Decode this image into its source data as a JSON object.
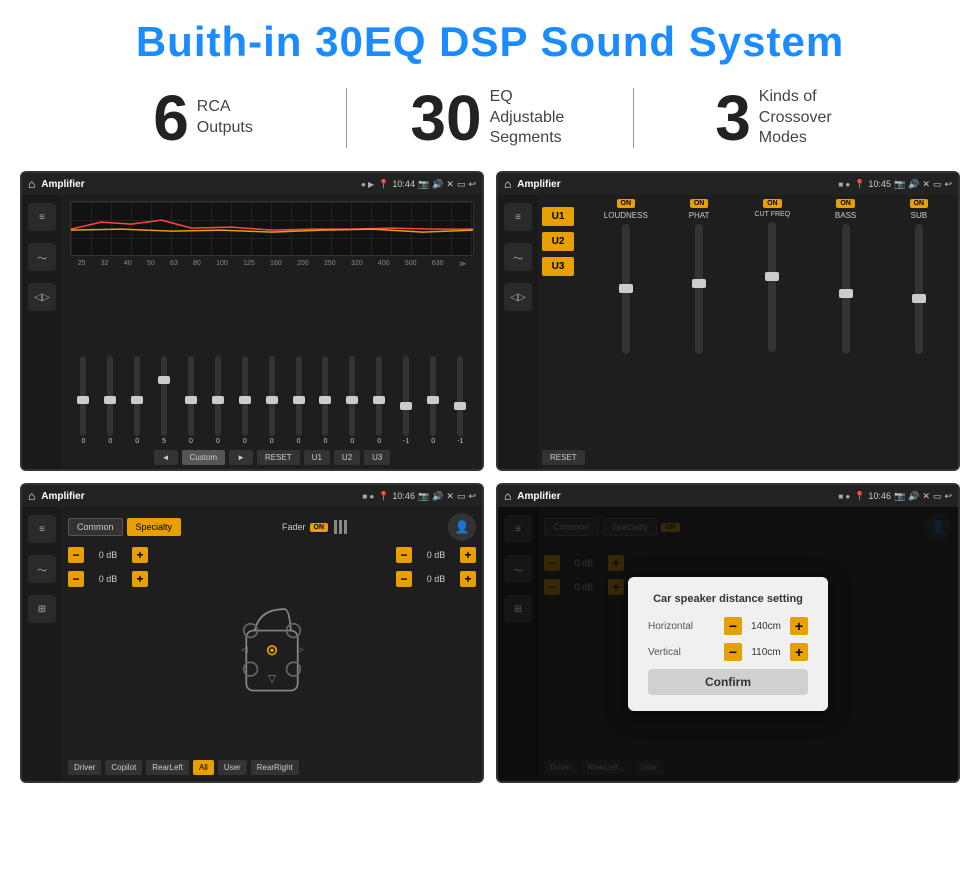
{
  "header": {
    "title": "Buith-in 30EQ DSP Sound System"
  },
  "stats": [
    {
      "number": "6",
      "label1": "RCA",
      "label2": "Outputs"
    },
    {
      "number": "30",
      "label1": "EQ Adjustable",
      "label2": "Segments"
    },
    {
      "number": "3",
      "label1": "Kinds of",
      "label2": "Crossover Modes"
    }
  ],
  "screens": [
    {
      "id": "screen1",
      "statusbar": {
        "app": "Amplifier",
        "time": "10:44"
      },
      "eq_freqs": [
        "25",
        "32",
        "40",
        "50",
        "63",
        "80",
        "100",
        "125",
        "160",
        "200",
        "250",
        "320",
        "400",
        "500",
        "630"
      ],
      "eq_vals": [
        "0",
        "0",
        "0",
        "5",
        "0",
        "0",
        "0",
        "0",
        "0",
        "0",
        "0",
        "0",
        "-1",
        "0",
        "-1"
      ],
      "bottom_btns": [
        "Custom",
        "RESET",
        "U1",
        "U2",
        "U3"
      ]
    },
    {
      "id": "screen2",
      "statusbar": {
        "app": "Amplifier",
        "time": "10:45"
      },
      "u_buttons": [
        "U1",
        "U2",
        "U3"
      ],
      "channels": [
        "LOUDNESS",
        "PHAT",
        "CUT FREQ",
        "BASS",
        "SUB"
      ],
      "reset_label": "RESET"
    },
    {
      "id": "screen3",
      "statusbar": {
        "app": "Amplifier",
        "time": "10:46"
      },
      "mode_btns": [
        "Common",
        "Specialty"
      ],
      "fader_label": "Fader",
      "controls": {
        "left_top": "0 dB",
        "left_bottom": "0 dB",
        "right_top": "0 dB",
        "right_bottom": "0 dB"
      },
      "bottom_btns": [
        "Driver",
        "Copilot",
        "RearLeft",
        "All",
        "User",
        "RearRight"
      ]
    },
    {
      "id": "screen4",
      "statusbar": {
        "app": "Amplifier",
        "time": "10:46"
      },
      "dialog": {
        "title": "Car speaker distance setting",
        "horizontal_label": "Horizontal",
        "horizontal_value": "140cm",
        "vertical_label": "Vertical",
        "vertical_value": "110cm",
        "confirm_label": "Confirm"
      },
      "controls": {
        "left_top": "0 dB",
        "left_bottom": "0 dB"
      }
    }
  ]
}
